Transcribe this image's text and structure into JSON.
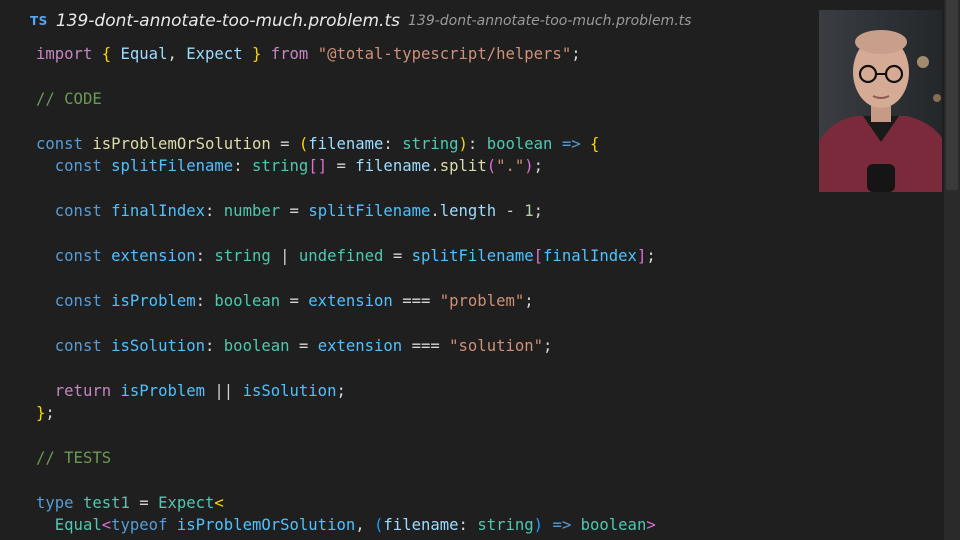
{
  "tab": {
    "badge": "TS",
    "filename": "139-dont-annotate-too-much.problem.ts",
    "path": "139-dont-annotate-too-much.problem.ts"
  },
  "code": {
    "l1": {
      "kw": "import",
      "b1": "{",
      "equal": "Equal",
      "comma": ",",
      "expect": "Expect",
      "b2": "}",
      "from": "from",
      "module": "\"@total-typescript/helpers\"",
      "semi": ";"
    },
    "l3": {
      "comment": "// CODE"
    },
    "l5": {
      "kw": "const",
      "name": "isProblemOrSolution",
      "eq": "=",
      "open": "(",
      "param": "filename",
      "colon": ":",
      "ptype": "string",
      "close": ")",
      "colon2": ":",
      "ret": "boolean",
      "arrow": "=>",
      "brace": "{"
    },
    "l6": {
      "kw": "const",
      "name": "splitFilename",
      "colon": ":",
      "type": "string",
      "brk": "[]",
      "eq": "=",
      "obj": "filename",
      "dot": ".",
      "fn": "split",
      "open": "(",
      "arg": "\".\"",
      "close": ")",
      "semi": ";"
    },
    "l8": {
      "kw": "const",
      "name": "finalIndex",
      "colon": ":",
      "type": "number",
      "eq": "=",
      "obj": "splitFilename",
      "dot": ".",
      "prop": "length",
      "minus": "-",
      "num": "1",
      "semi": ";"
    },
    "l10": {
      "kw": "const",
      "name": "extension",
      "colon": ":",
      "type": "string",
      "bar": "|",
      "type2": "undefined",
      "eq": "=",
      "obj": "splitFilename",
      "open": "[",
      "idx": "finalIndex",
      "close": "]",
      "semi": ";"
    },
    "l12": {
      "kw": "const",
      "name": "isProblem",
      "colon": ":",
      "type": "boolean",
      "eq": "=",
      "ref": "extension",
      "op": "===",
      "str": "\"problem\"",
      "semi": ";"
    },
    "l14": {
      "kw": "const",
      "name": "isSolution",
      "colon": ":",
      "type": "boolean",
      "eq": "=",
      "ref": "extension",
      "op": "===",
      "str": "\"solution\"",
      "semi": ";"
    },
    "l16": {
      "kw": "return",
      "a": "isProblem",
      "op": "||",
      "b": "isSolution",
      "semi": ";"
    },
    "l17": {
      "brace": "}",
      "semi": ";"
    },
    "l19": {
      "comment": "// TESTS"
    },
    "l21": {
      "kw": "type",
      "name": "test1",
      "eq": "=",
      "gen": "Expect",
      "lt": "<"
    },
    "l22": {
      "gen": "Equal",
      "lt": "<",
      "typeof": "typeof",
      "ref": "isProblemOrSolution",
      "comma": ",",
      "open": "(",
      "param": "filename",
      "colon": ":",
      "ptype": "string",
      "close": ")",
      "arrow": "=>",
      "ret": "boolean",
      "gt": ">"
    }
  }
}
